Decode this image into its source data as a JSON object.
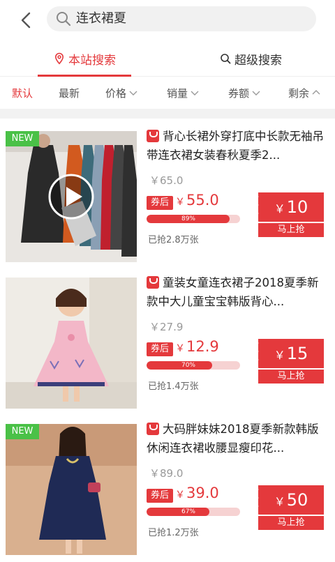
{
  "search": {
    "query": "连衣裙夏"
  },
  "tabs": [
    {
      "label": "本站搜索"
    },
    {
      "label": "超级搜索"
    }
  ],
  "sort": [
    "默认",
    "最新",
    "价格",
    "销量",
    "券额",
    "剩余"
  ],
  "colors": {
    "accent": "#e4393c",
    "new_badge": "#4ac147"
  },
  "items": [
    {
      "badge": "NEW",
      "has_video": true,
      "title": "背心长裙外穿打底中长款无袖吊带连衣裙女装春秋夏季2...",
      "orig_price": "￥65.0",
      "after_label": "券后",
      "price_cur": "￥",
      "price": "55.0",
      "progress": 0.89,
      "progress_text": "89%",
      "sold": "已抢2.8万张",
      "coupon_cur": "￥",
      "coupon": "10",
      "coupon_btn": "马上抢"
    },
    {
      "badge": "",
      "has_video": false,
      "title": "童装女童连衣裙子2018夏季新款中大儿童宝宝韩版背心...",
      "orig_price": "￥27.9",
      "after_label": "券后",
      "price_cur": "￥",
      "price": "12.9",
      "progress": 0.7,
      "progress_text": "70%",
      "sold": "已抢1.4万张",
      "coupon_cur": "￥",
      "coupon": "15",
      "coupon_btn": "马上抢"
    },
    {
      "badge": "NEW",
      "has_video": false,
      "title": "大码胖妹妹2018夏季新款韩版休闲连衣裙收腰显瘦印花...",
      "orig_price": "￥89.0",
      "after_label": "券后",
      "price_cur": "￥",
      "price": "39.0",
      "progress": 0.67,
      "progress_text": "67%",
      "sold": "已抢1.2万张",
      "coupon_cur": "￥",
      "coupon": "50",
      "coupon_btn": "马上抢"
    }
  ]
}
